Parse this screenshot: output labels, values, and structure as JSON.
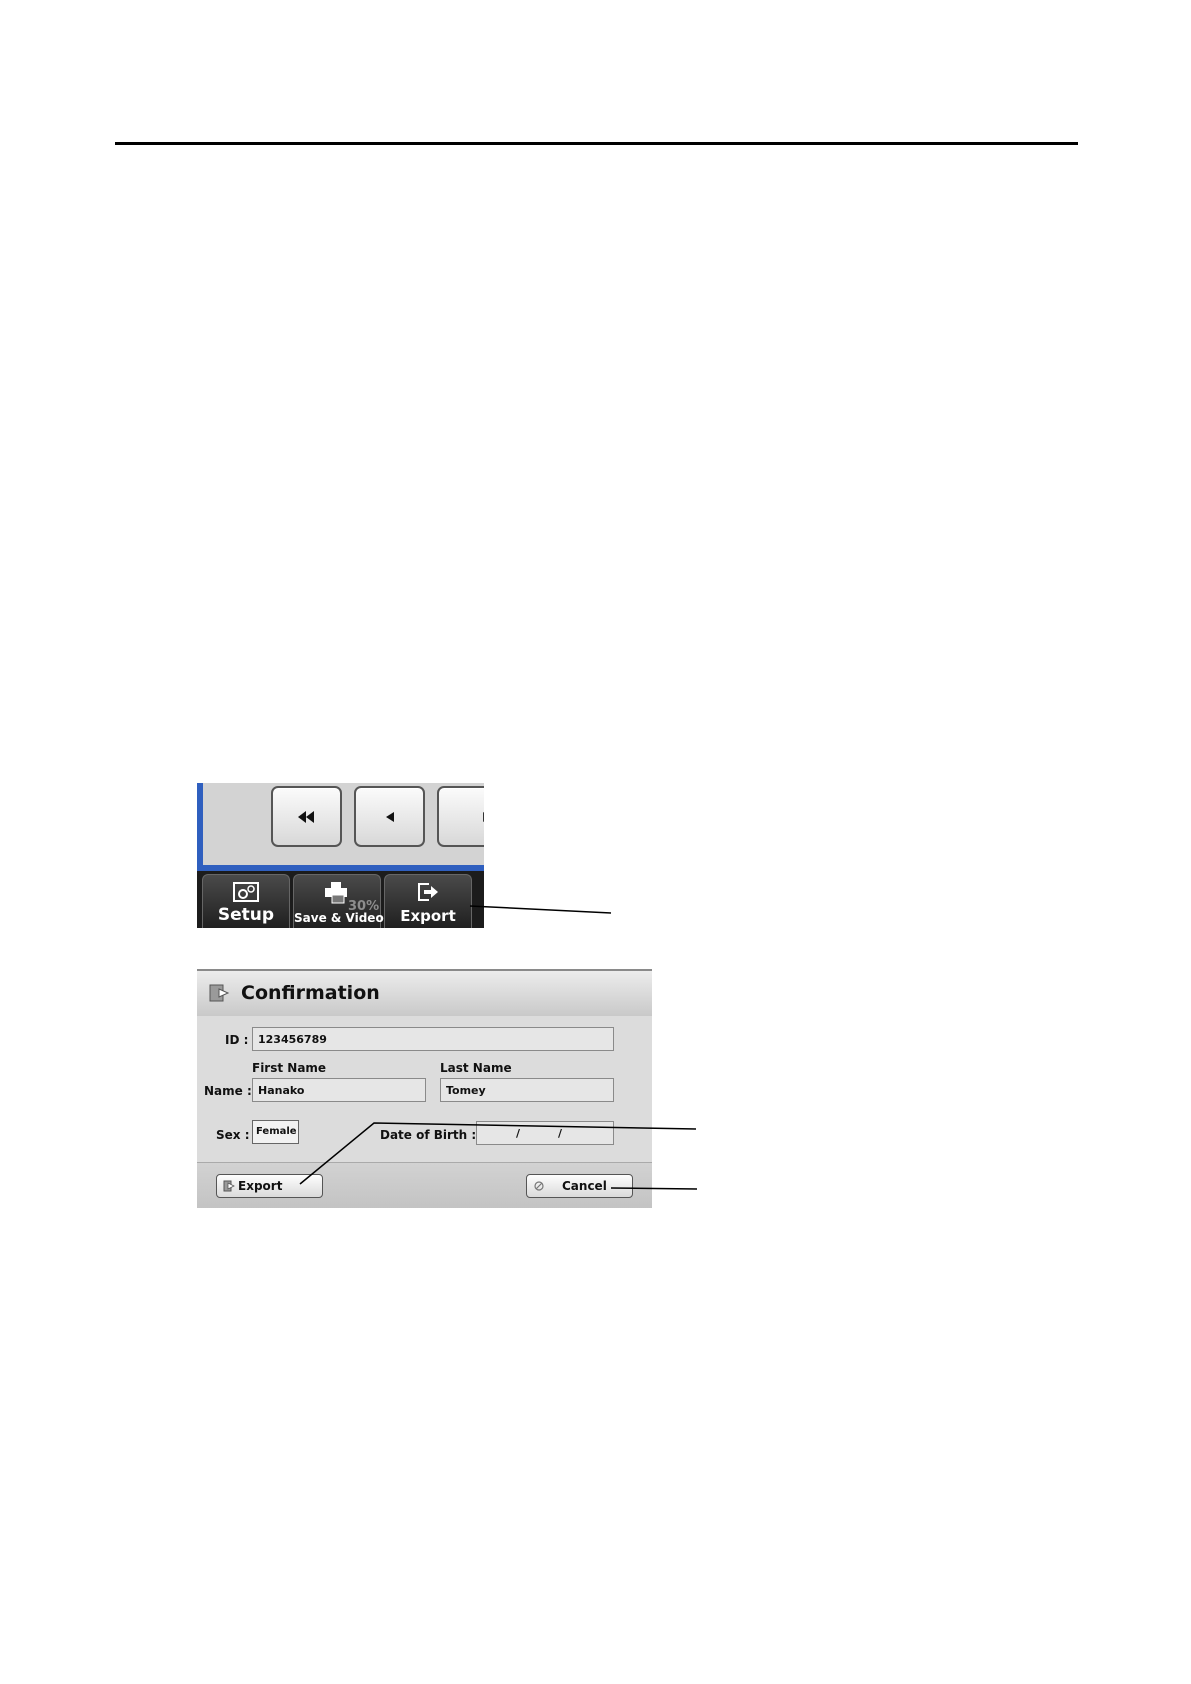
{
  "toolbar": {
    "buttons": [
      {
        "label": "Setup",
        "icon": "setup-gear-icon"
      },
      {
        "label": "Save & Video",
        "icon": "printer-icon",
        "badge": "30%"
      },
      {
        "label": "Export",
        "icon": "export-arrow-icon"
      }
    ],
    "playback_icons": [
      "rewind-icon",
      "step-back-icon",
      "play-icon"
    ]
  },
  "dialog": {
    "title": "Confirmation",
    "id_label": "ID :",
    "id_value": "123456789",
    "name_label": "Name :",
    "first_name_label": "First Name",
    "first_name_value": "Hanako",
    "last_name_label": "Last Name",
    "last_name_value": "Tomey",
    "sex_label": "Sex :",
    "sex_value": "Female",
    "dob_label": "Date of Birth :",
    "dob_separator_1": "/",
    "dob_separator_2": "/",
    "export_button": "Export",
    "cancel_button": "Cancel"
  },
  "colors": {
    "accent_blue": "#2f5fbf",
    "toolbar_dark": "#1c1c1c",
    "dialog_bg": "#dcdcdc"
  }
}
